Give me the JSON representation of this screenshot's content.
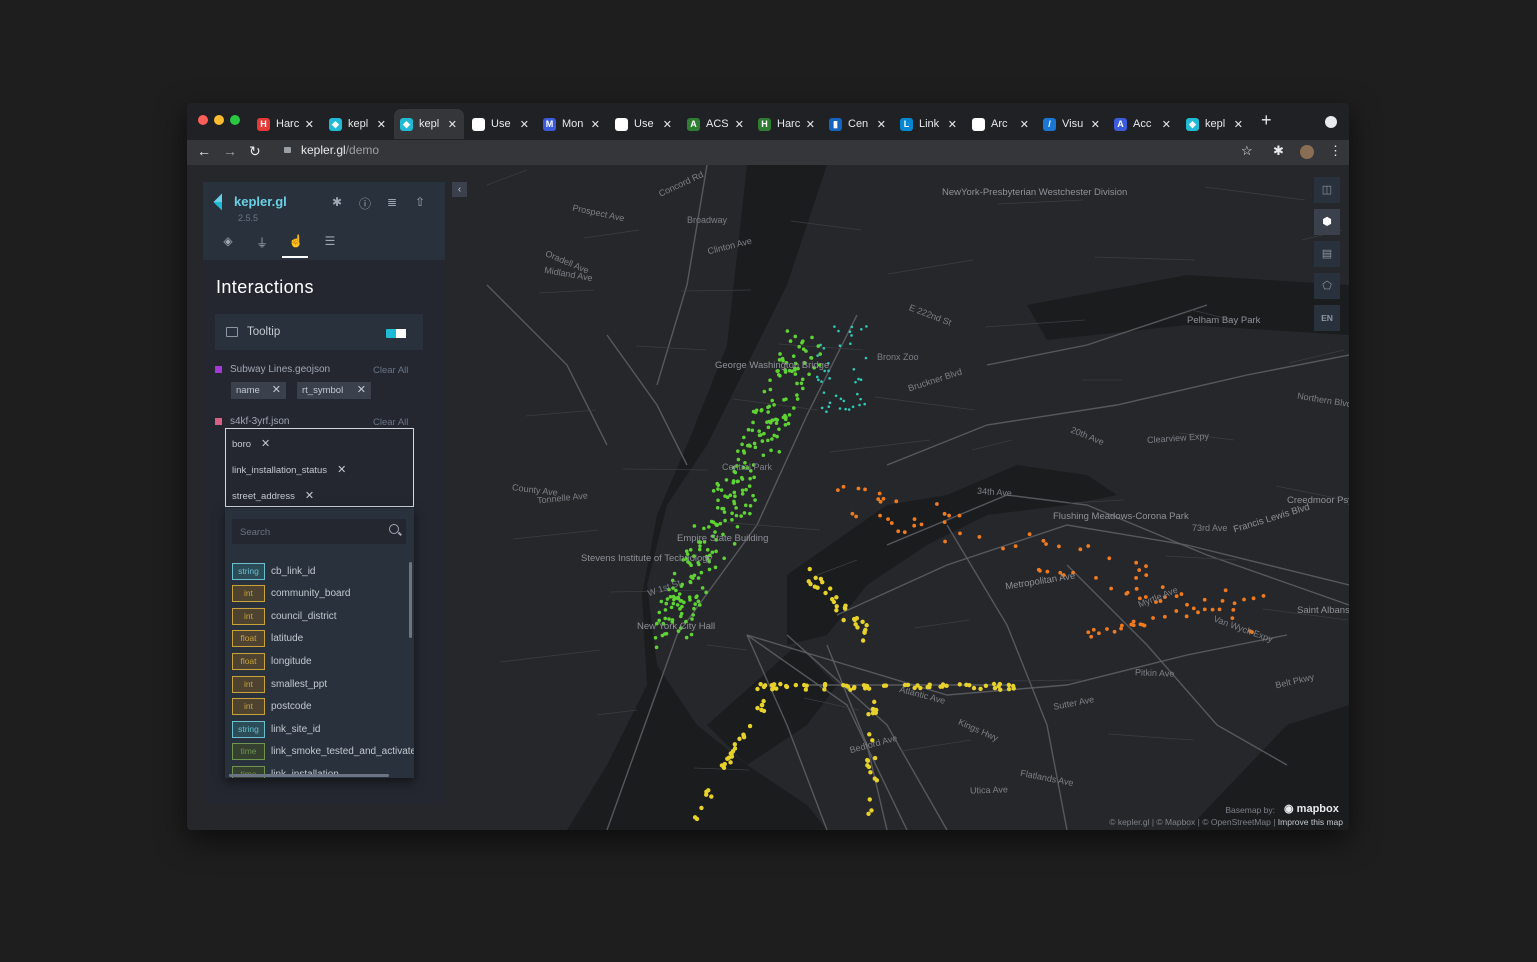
{
  "browser": {
    "tabs": [
      {
        "label": "Harc",
        "fav": "#e53935",
        "glyph": "H"
      },
      {
        "label": "kepl",
        "fav": "#1fbad6",
        "glyph": "◆"
      },
      {
        "label": "kepl",
        "fav": "#1fbad6",
        "glyph": "◆",
        "active": true
      },
      {
        "label": "Use",
        "fav": "#ffffff",
        "glyph": ""
      },
      {
        "label": "Mon",
        "fav": "#3b5bdb",
        "glyph": "M"
      },
      {
        "label": "Use",
        "fav": "#ffffff",
        "glyph": ""
      },
      {
        "label": "ACS",
        "fav": "#2e7d32",
        "glyph": "A"
      },
      {
        "label": "Harc",
        "fav": "#2e7d32",
        "glyph": "H"
      },
      {
        "label": "Cen",
        "fav": "#1565c0",
        "glyph": "▮"
      },
      {
        "label": "Link",
        "fav": "#0288d1",
        "glyph": "L"
      },
      {
        "label": "Arc",
        "fav": "#ffffff",
        "glyph": ""
      },
      {
        "label": "Visu",
        "fav": "#1976d2",
        "glyph": "/"
      },
      {
        "label": "Acc",
        "fav": "#3b5bdb",
        "glyph": "A"
      },
      {
        "label": "kepl",
        "fav": "#1fbad6",
        "glyph": "◆"
      }
    ],
    "close_glyph": "✕",
    "new_tab": "+",
    "url_host": "kepler.gl",
    "url_path": "/demo",
    "back": "←",
    "forward": "→",
    "reload": "↻",
    "star": "☆",
    "extensions": "✱",
    "menu": "⋮"
  },
  "panel": {
    "app_name": "kepler.gl",
    "version": "2.5.5",
    "header_icons": [
      "bug-icon",
      "info-icon",
      "database-icon",
      "share-icon"
    ],
    "title": "Interactions",
    "tooltip_label": "Tooltip",
    "tooltip_enabled": true,
    "datasets": [
      {
        "name": "Subway Lines.geojson",
        "color": "#a438d8",
        "clear": "Clear All",
        "fields": [
          "name",
          "rt_symbol"
        ]
      },
      {
        "name": "s4kf-3yrf.json",
        "color": "#d85f85",
        "clear": "Clear All",
        "fields": [
          "boro",
          "link_installation_status",
          "street_address"
        ]
      }
    ],
    "search_placeholder": "Search",
    "field_options": [
      {
        "type": "string",
        "name": "cb_link_id"
      },
      {
        "type": "int",
        "name": "community_board"
      },
      {
        "type": "int",
        "name": "council_district"
      },
      {
        "type": "float",
        "name": "latitude"
      },
      {
        "type": "float",
        "name": "longitude"
      },
      {
        "type": "int",
        "name": "smallest_ppt"
      },
      {
        "type": "int",
        "name": "postcode"
      },
      {
        "type": "string",
        "name": "link_site_id"
      },
      {
        "type": "time",
        "name": "link_smoke_tested_and_activated"
      },
      {
        "type": "time",
        "name": "link_installation"
      }
    ]
  },
  "map": {
    "controls": [
      "split-map-icon",
      "3d-view-icon",
      "legend-icon",
      "draw-icon",
      "EN"
    ],
    "labels": [
      "Concord Rd",
      "Prospect Ave",
      "Broadway",
      "Clinton Ave",
      "Oradell Ave",
      "Midland Ave",
      "NewYork-Presbyterian Westchester Division",
      "Pelham Bay Park",
      "E 222nd St",
      "George Washington Bridge",
      "Bronx Zoo",
      "Bruckner Blvd",
      "Central Park",
      "Empire State Building",
      "Stevens Institute of Technology",
      "New York City Hall",
      "Flushing Meadows-Corona Park",
      "34th Ave",
      "Metropolitan Ave",
      "Myrtle Ave",
      "Atlantic Ave",
      "Pitkin Ave",
      "Sutter Ave",
      "Saint Albans Living",
      "Creedmoor Psychiatric",
      "73rd Ave",
      "Belt Pkwy",
      "Kings Hwy",
      "Flatlands Ave",
      "Utica Ave",
      "Bedford Ave",
      "20th Ave",
      "Northern Blvd",
      "Clearview Expy",
      "Francis Lewis Blvd",
      "Van Wyck Expy",
      "County Ave",
      "Tonnelle Ave",
      "W 1st St"
    ],
    "basemap_by": "Basemap by:",
    "mapbox": "mapbox",
    "attribution": "© kepler.gl | © Mapbox | © OpenStreetMap |",
    "improve": "Improve this map"
  },
  "colors": {
    "subway": "#5fd335",
    "uptown": "#2ec9b8",
    "queens": "#f07a1f",
    "brooklyn": "#e7d22b",
    "accent": "#1fbad6"
  }
}
